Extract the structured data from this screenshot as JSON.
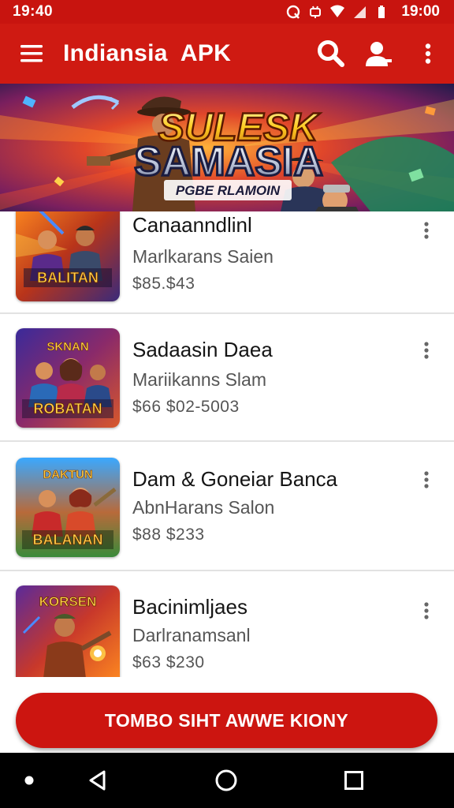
{
  "status_bar": {
    "time_left": "19:40",
    "time_right": "19:00",
    "icons": [
      "q-notification-icon",
      "robot-notification-icon",
      "wifi-icon",
      "signal-icon",
      "battery-icon"
    ]
  },
  "app_bar": {
    "title": "Indiansia  APK",
    "icons": [
      "menu-icon",
      "search-icon",
      "account-icon",
      "more-vert-icon"
    ]
  },
  "banner": {
    "headline_1": "SULESK",
    "headline_2": "SAMASIA",
    "tagline": "PGBE RLAMOIN"
  },
  "apps": [
    {
      "title": "Canaanndlinl",
      "subtitle": "Marlkarans Saien",
      "price": "$85.$43",
      "thumb_caption": "BALITAN"
    },
    {
      "title": "Sadaasin Daea",
      "subtitle": "Mariikanns Slam",
      "price": "$66  $02-5003",
      "thumb_caption": "ROBATAN"
    },
    {
      "title": "Dam & Goneiar Banca",
      "subtitle": "AbnHarans Salon",
      "price": "$88  $233",
      "thumb_caption": "BALANAN"
    },
    {
      "title": "Bacinimljaes",
      "subtitle": "Darlranamsanl",
      "price": "$63  $230",
      "thumb_caption": "KORSEN"
    }
  ],
  "cta": {
    "label": "TOMBO SIHT  AWWE KIONY"
  },
  "nav_bar": {
    "icons": [
      "dot-icon",
      "back-icon",
      "home-icon",
      "recents-icon"
    ]
  },
  "colors": {
    "primary": "#cf1a12",
    "status_bar": "#c8140f",
    "cta": "#cc1510",
    "divider": "#e2e2e2"
  }
}
